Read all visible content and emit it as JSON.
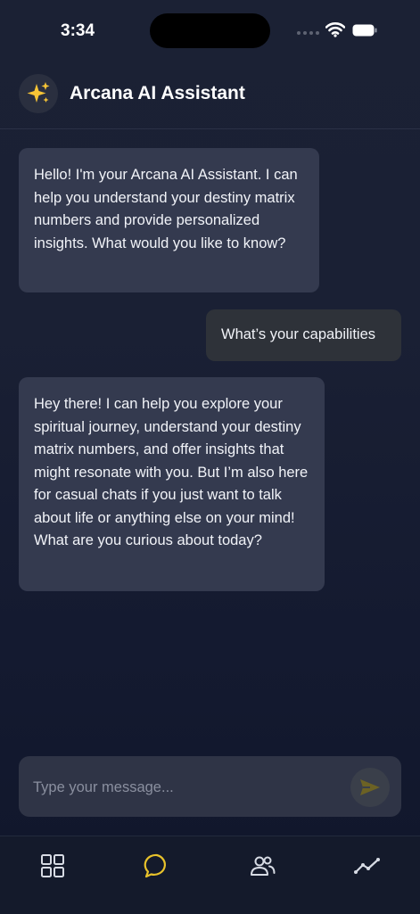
{
  "status_bar": {
    "time": "3:34"
  },
  "header": {
    "icon": "sparkles-icon",
    "title": "Arcana AI Assistant"
  },
  "messages": [
    {
      "role": "assistant",
      "text": "Hello! I'm your Arcana AI Assistant. I can help you understand your destiny matrix numbers and provide personalized insights. What would you like to know?"
    },
    {
      "role": "user",
      "text": "What’s your capabilities"
    },
    {
      "role": "assistant",
      "text": "Hey there! I can help you explore your spiritual journey, understand your destiny matrix numbers, and offer insights that might resonate with you. But I’m also here for casual chats if you just want to talk about life or anything else on your mind! What are you curious about today?"
    }
  ],
  "composer": {
    "placeholder": "Type your message...",
    "value": ""
  },
  "tabbar": {
    "items": [
      {
        "icon": "grid-icon",
        "active": false
      },
      {
        "icon": "chat-bubble-icon",
        "active": true
      },
      {
        "icon": "people-icon",
        "active": false
      },
      {
        "icon": "trend-line-icon",
        "active": false
      }
    ]
  },
  "colors": {
    "accent": "#e8c22b",
    "bubble": "#343a4f",
    "user_bubble": "#2e3239",
    "background": "#1a2034"
  }
}
